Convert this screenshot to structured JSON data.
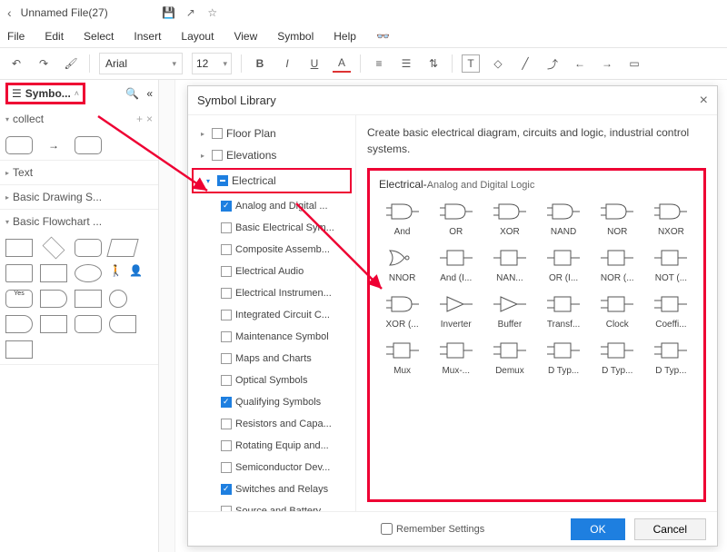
{
  "titlebar": {
    "filename": "Unnamed File(27)"
  },
  "menu": {
    "file": "File",
    "edit": "Edit",
    "select": "Select",
    "insert": "Insert",
    "layout": "Layout",
    "view": "View",
    "symbol": "Symbol",
    "help": "Help"
  },
  "toolbar": {
    "font": "Arial",
    "size": "12"
  },
  "sidebar": {
    "lib_label": "Symbo...",
    "sections": {
      "collect": "collect",
      "text": "Text",
      "basic_drawing": "Basic Drawing S...",
      "basic_flowchart": "Basic Flowchart ..."
    }
  },
  "dialog": {
    "title": "Symbol Library",
    "desc": "Create basic electrical diagram, circuits and logic, industrial control systems.",
    "tree": {
      "floor": "Floor Plan",
      "elev": "Elevations",
      "elec": "Electrical",
      "items": [
        "Analog and Digital ...",
        "Basic Electrical Sym...",
        "Composite Assemb...",
        "Electrical Audio",
        "Electrical Instrumen...",
        "Integrated Circuit C...",
        "Maintenance Symbol",
        "Maps and Charts",
        "Optical Symbols",
        "Qualifying Symbols",
        "Resistors and Capa...",
        "Rotating Equip and...",
        "Semiconductor Dev...",
        "Switches and Relays",
        "Source and Battery"
      ]
    },
    "preview": {
      "title_main": "Electrical-",
      "title_sub": "Analog and Digital Logic",
      "symbols": [
        "And",
        "OR",
        "XOR",
        "NAND",
        "NOR",
        "NXOR",
        "NNOR",
        "And (I...",
        "NAN...",
        "OR (I...",
        "NOR (...",
        "NOT (...",
        "XOR (...",
        "Inverter",
        "Buffer",
        "Transf...",
        "Clock",
        "Coeffi...",
        "Mux",
        "Mux-...",
        "Demux",
        "D Typ...",
        "D Typ...",
        "D Typ..."
      ]
    },
    "remember": "Remember Settings",
    "ok": "OK",
    "cancel": "Cancel"
  }
}
